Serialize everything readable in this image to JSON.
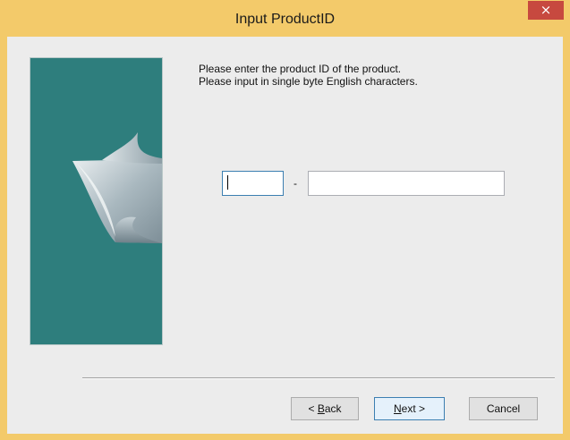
{
  "window": {
    "title": "Input ProductID",
    "close_glyph": "×",
    "titlebar_color": "#f3ca6a",
    "close_color": "#c7493f"
  },
  "side_panel": {
    "color": "#2e7e7d",
    "graphic": "silver-paper-fold"
  },
  "instructions": {
    "line1": "Please enter the product ID of the product.",
    "line2": "Please input in single byte English characters."
  },
  "product_id": {
    "part1_value": "",
    "separator": "-",
    "part2_value": ""
  },
  "buttons": {
    "back_prefix": "< ",
    "back_mnemonic": "B",
    "back_rest": "ack",
    "next_mnemonic": "N",
    "next_rest": "ext >",
    "cancel": "Cancel"
  }
}
